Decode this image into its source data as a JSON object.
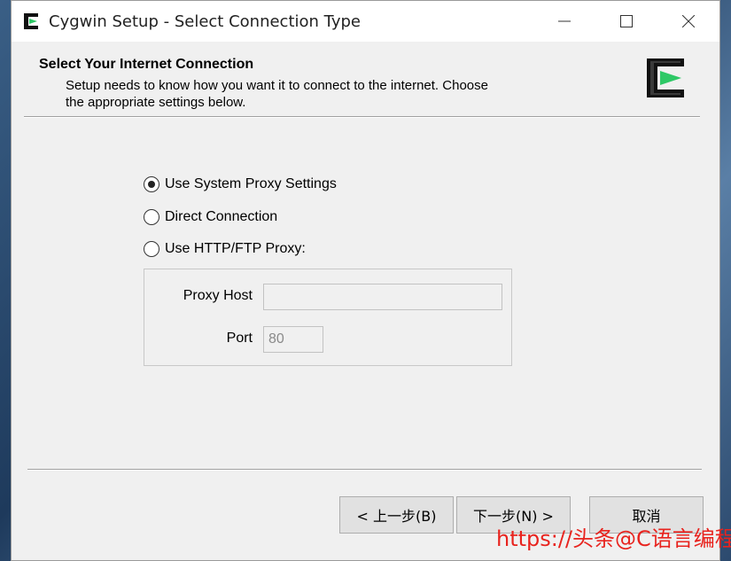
{
  "window": {
    "title": "Cygwin Setup - Select Connection Type"
  },
  "header": {
    "title": "Select Your Internet Connection",
    "subtitle_line1": "Setup needs to know how you want it to connect to the internet.  Choose",
    "subtitle_line2": "the appropriate settings below."
  },
  "options": {
    "system_proxy": {
      "label": "Use System Proxy Settings",
      "checked": true
    },
    "direct": {
      "label": "Direct Connection",
      "checked": false
    },
    "http_ftp": {
      "label": "Use HTTP/FTP Proxy:",
      "checked": false
    }
  },
  "proxy": {
    "host_label": "Proxy Host",
    "host_value": "",
    "port_label": "Port",
    "port_value": "80"
  },
  "buttons": {
    "back": "< 上一步(B)",
    "next": "下一步(N) >",
    "cancel": "取消"
  },
  "watermark": "https://头条@C语言编程",
  "colors": {
    "logo_green": "#2ec866",
    "watermark_red": "#e8231e"
  },
  "icons": [
    "cygwin-logo-icon",
    "minimize-icon",
    "maximize-icon",
    "close-icon"
  ]
}
